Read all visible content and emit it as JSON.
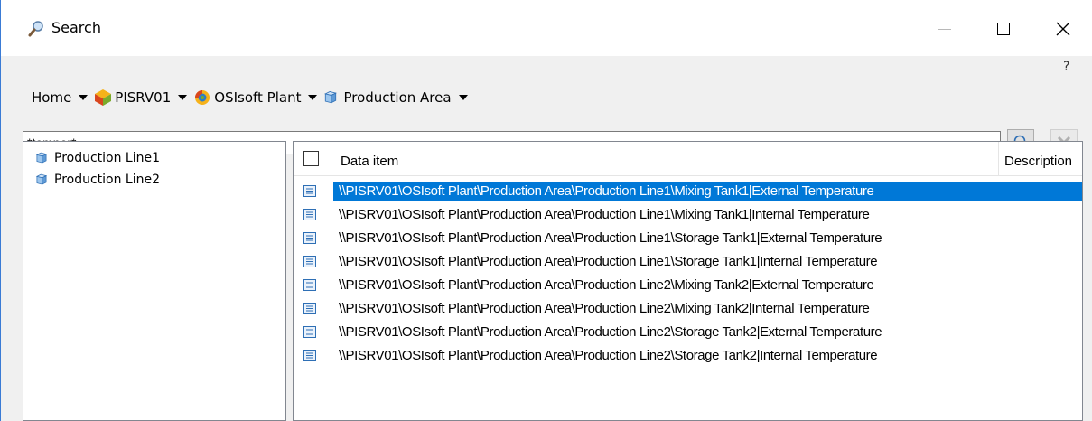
{
  "window": {
    "title": "Search",
    "help_label": "?"
  },
  "breadcrumb": [
    {
      "label": "Home",
      "icon": "none"
    },
    {
      "label": "PISRV01",
      "icon": "server-icon"
    },
    {
      "label": "OSIsoft Plant",
      "icon": "database-icon"
    },
    {
      "label": "Production Area",
      "icon": "element-icon"
    }
  ],
  "search": {
    "value": "*temper*",
    "placeholder": ""
  },
  "tree": {
    "items": [
      {
        "label": "Production Line1"
      },
      {
        "label": "Production Line2"
      }
    ]
  },
  "list": {
    "columns": [
      "Data item",
      "Description"
    ],
    "rows": [
      {
        "path": "\\\\PISRV01\\OSIsoft Plant\\Production Area\\Production Line1\\Mixing Tank1|External Temperature",
        "selected": true
      },
      {
        "path": "\\\\PISRV01\\OSIsoft Plant\\Production Area\\Production Line1\\Mixing Tank1|Internal Temperature",
        "selected": false
      },
      {
        "path": "\\\\PISRV01\\OSIsoft Plant\\Production Area\\Production Line1\\Storage Tank1|External Temperature",
        "selected": false
      },
      {
        "path": "\\\\PISRV01\\OSIsoft Plant\\Production Area\\Production Line1\\Storage Tank1|Internal Temperature",
        "selected": false
      },
      {
        "path": "\\\\PISRV01\\OSIsoft Plant\\Production Area\\Production Line2\\Mixing Tank2|External Temperature",
        "selected": false
      },
      {
        "path": "\\\\PISRV01\\OSIsoft Plant\\Production Area\\Production Line2\\Mixing Tank2|Internal Temperature",
        "selected": false
      },
      {
        "path": "\\\\PISRV01\\OSIsoft Plant\\Production Area\\Production Line2\\Storage Tank2|External Temperature",
        "selected": false
      },
      {
        "path": "\\\\PISRV01\\OSIsoft Plant\\Production Area\\Production Line2\\Storage Tank2|Internal Temperature",
        "selected": false
      }
    ]
  },
  "colors": {
    "selection": "#0078d7",
    "window_border": "#3a7bd5"
  }
}
